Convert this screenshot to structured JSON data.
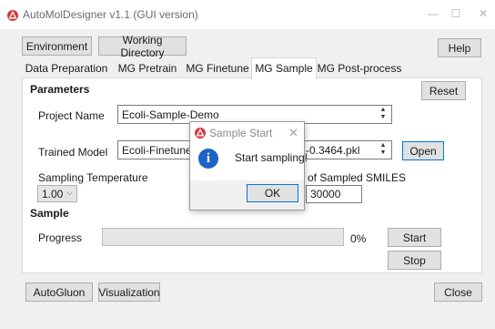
{
  "app": {
    "title": "AutoMolDesigner v1.1 (GUI version)"
  },
  "window_controls": {
    "minimize": "—",
    "maximize": "☐",
    "close": "✕"
  },
  "toolbar": {
    "environment": "Environment",
    "working_directory": "Working Directory",
    "help": "Help"
  },
  "tabs": [
    {
      "label": "Data Preparation",
      "active": false
    },
    {
      "label": "MG Pretrain",
      "active": false
    },
    {
      "label": "MG Finetune",
      "active": false
    },
    {
      "label": "MG Sample",
      "active": true
    },
    {
      "label": "MG Post-process",
      "active": false
    }
  ],
  "parameters": {
    "heading": "Parameters",
    "reset": "Reset",
    "project_name_label": "Project Name",
    "project_name_value": "Ecoli-Sample-Demo",
    "trained_model_label": "Trained Model",
    "trained_model_value_left": "Ecoli-Finetune-D",
    "trained_model_value_right": "-0.3464.pkl",
    "open": "Open",
    "temp_label": "Sampling Temperature",
    "temp_value": "1.00",
    "num_smiles_label": "of Sampled SMILES",
    "num_smiles_value": "30000"
  },
  "sample": {
    "heading": "Sample",
    "progress_label": "Progress",
    "progress_text": "0%",
    "progress_value": 0,
    "start": "Start",
    "stop": "Stop"
  },
  "footer": {
    "autogluon": "AutoGluon",
    "visualization": "Visualization",
    "close": "Close"
  },
  "dialog": {
    "title": "Sample Start",
    "message": "Start sampling!",
    "ok": "OK",
    "close": "✕",
    "info_glyph": "i"
  },
  "colors": {
    "progress_fill": "#06b025",
    "focus_border": "#0078d7",
    "info_icon": "#1c64c8"
  }
}
